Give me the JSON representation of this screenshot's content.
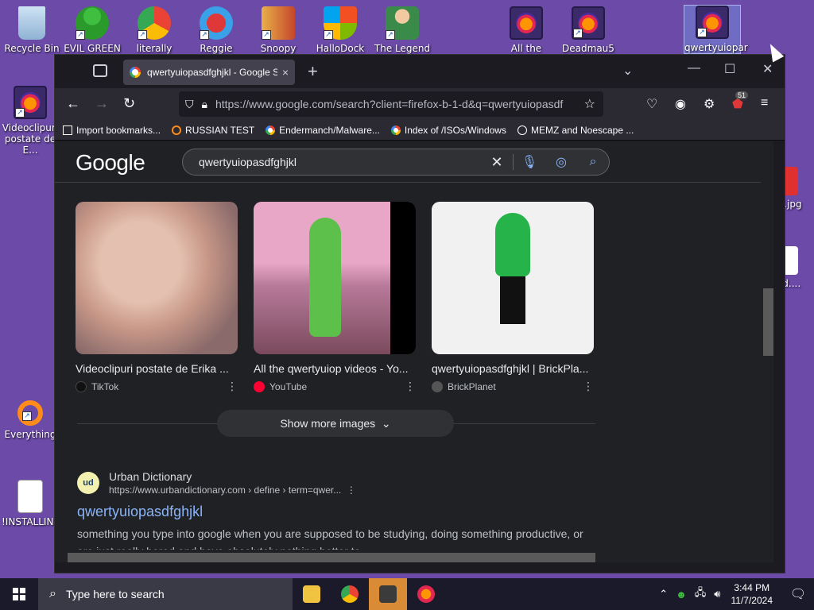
{
  "desktop": {
    "icons": [
      {
        "label": "Recycle Bin"
      },
      {
        "label": "EVIL GREEN"
      },
      {
        "label": "literally"
      },
      {
        "label": "Reggie Nights"
      },
      {
        "label": "Snoopy"
      },
      {
        "label": "HalloDock"
      },
      {
        "label": "The Legend"
      },
      {
        "label": "All the"
      },
      {
        "label": "Deadmau5 -"
      },
      {
        "label": "qwertyuiopar"
      },
      {
        "label": "Videoclipuri postate de E..."
      },
      {
        "label": "Everything"
      },
      {
        "label": "!INSTALLIN..."
      },
      {
        "label": "...l.jpg"
      },
      {
        "label": "...d...."
      }
    ]
  },
  "browser": {
    "tab": {
      "title": "qwertyuiopasdfghjkl - Google S",
      "close": "×"
    },
    "new_tab": "+",
    "window_controls": {
      "minimize": "—",
      "maximize": "☐",
      "close": "✕"
    },
    "url": "https://www.google.com/search?client=firefox-b-1-d&q=qwertyuiopasdf",
    "extension_badge": "51",
    "bookmarks": [
      {
        "label": "Import bookmarks..."
      },
      {
        "label": "RUSSIAN TEST"
      },
      {
        "label": "Endermanch/Malware..."
      },
      {
        "label": "Index of /ISOs/Windows"
      },
      {
        "label": "MEMZ and Noescape ..."
      }
    ]
  },
  "google": {
    "logo": "Google",
    "query": "qwertyuiopasdfghjkl",
    "images": [
      {
        "title": "Videoclipuri postate de Erika ...",
        "source": "TikTok"
      },
      {
        "title": "All the qwertyuiop videos - Yo...",
        "source": "YouTube"
      },
      {
        "title": "qwertyuiopasdfghjkl | BrickPla...",
        "source": "BrickPlanet"
      }
    ],
    "show_more": "Show more images",
    "result": {
      "favicon": "ud",
      "site": "Urban Dictionary",
      "url": "https://www.urbandictionary.com › define › term=qwer...",
      "title": "qwertyuiopasdfghjkl",
      "snippet": "something you type into google when you are supposed to be studying, doing something productive, or are just really bored and have absolutely nothing better to ..."
    }
  },
  "taskbar": {
    "search_placeholder": "Type here to search",
    "time": "3:44 PM",
    "date": "11/7/2024"
  }
}
